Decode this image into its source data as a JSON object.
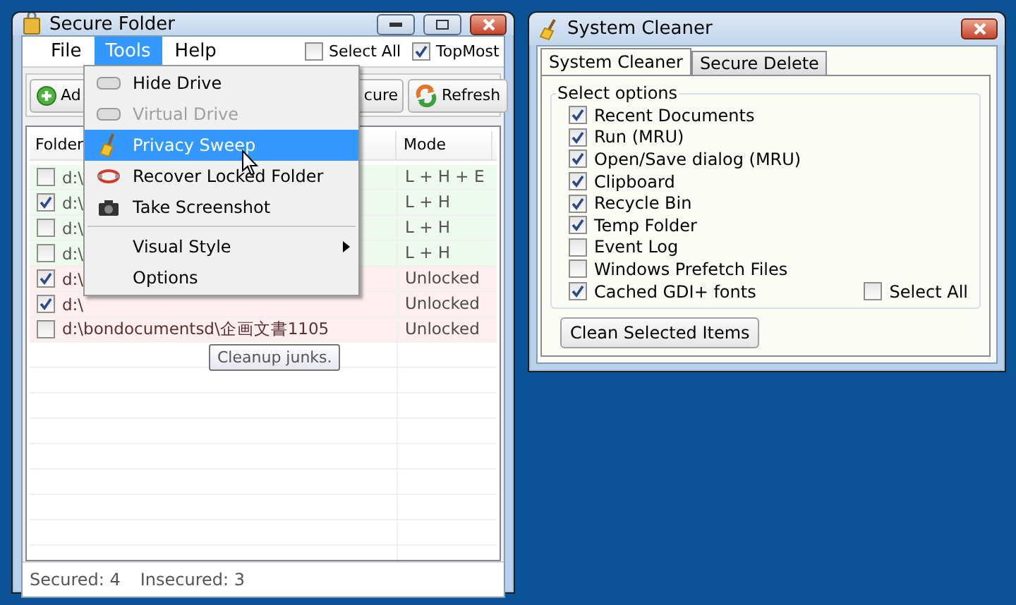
{
  "secure_folder": {
    "title": "Secure Folder",
    "menu": [
      {
        "label": "File",
        "selected": false
      },
      {
        "label": "Tools",
        "selected": true
      },
      {
        "label": "Help",
        "selected": false
      }
    ],
    "select_all": {
      "label": "Select All",
      "checked": false
    },
    "topmost": {
      "label": "TopMost",
      "checked": true
    },
    "toolbar": [
      {
        "kind": "add",
        "label": "Ad"
      },
      {
        "kind": "secure",
        "label": "cure"
      },
      {
        "kind": "refresh",
        "label": "Refresh"
      }
    ],
    "table": {
      "columns": [
        "Folder",
        "Mode"
      ],
      "rows": [
        {
          "checked": false,
          "folder": "d:\\",
          "mode": "L + H + E",
          "secured": true
        },
        {
          "checked": true,
          "folder": "d:\\",
          "mode": "L + H",
          "secured": true
        },
        {
          "checked": false,
          "folder": "d:\\",
          "mode": "L + H",
          "secured": true
        },
        {
          "checked": false,
          "folder": "d:\\",
          "mode": "L + H",
          "secured": true
        },
        {
          "checked": true,
          "folder": "d:\\",
          "mode": "Unlocked",
          "secured": false
        },
        {
          "checked": true,
          "folder": "d:\\",
          "mode": "Unlocked",
          "secured": false
        },
        {
          "checked": false,
          "folder": "d:\\bondocumentsd\\企画文書1105",
          "mode": "Unlocked",
          "secured": false
        }
      ]
    },
    "status_bar": {
      "secured": "Secured: 4",
      "insecured": "Insecured: 3"
    },
    "tools_menu": {
      "items": [
        {
          "kind": "item",
          "label": "Hide Drive",
          "disabled": false,
          "selected": false,
          "submenu": false
        },
        {
          "kind": "item",
          "label": "Virtual Drive",
          "disabled": true,
          "selected": false,
          "submenu": false
        },
        {
          "kind": "item",
          "label": "Privacy Sweep",
          "disabled": false,
          "selected": true,
          "submenu": false
        },
        {
          "kind": "item",
          "label": "Recover Locked Folder",
          "disabled": false,
          "selected": false,
          "submenu": false
        },
        {
          "kind": "item",
          "label": "Take Screenshot",
          "disabled": false,
          "selected": false,
          "submenu": false
        },
        {
          "kind": "separator"
        },
        {
          "kind": "item",
          "label": "Visual Style",
          "disabled": false,
          "selected": false,
          "submenu": true
        },
        {
          "kind": "item",
          "label": "Options",
          "disabled": false,
          "selected": false,
          "submenu": false
        }
      ]
    },
    "tooltip": "Cleanup junks."
  },
  "system_cleaner": {
    "title": "System Cleaner",
    "tabs": [
      {
        "label": "System Cleaner",
        "selected": true
      },
      {
        "label": "Secure Delete",
        "selected": false
      }
    ],
    "group_title": "Select options",
    "options": [
      {
        "label": "Recent Documents",
        "checked": true
      },
      {
        "label": "Run (MRU)",
        "checked": true
      },
      {
        "label": "Open/Save dialog (MRU)",
        "checked": true
      },
      {
        "label": "Clipboard",
        "checked": true
      },
      {
        "label": "Recycle Bin",
        "checked": true
      },
      {
        "label": "Temp Folder",
        "checked": true
      },
      {
        "label": "Event Log",
        "checked": false
      },
      {
        "label": "Windows Prefetch Files",
        "checked": false
      },
      {
        "label": "Cached GDI+ fonts",
        "checked": true
      }
    ],
    "select_all": {
      "label": "Select All",
      "checked": false
    },
    "clean_button": "Clean Selected Items"
  }
}
